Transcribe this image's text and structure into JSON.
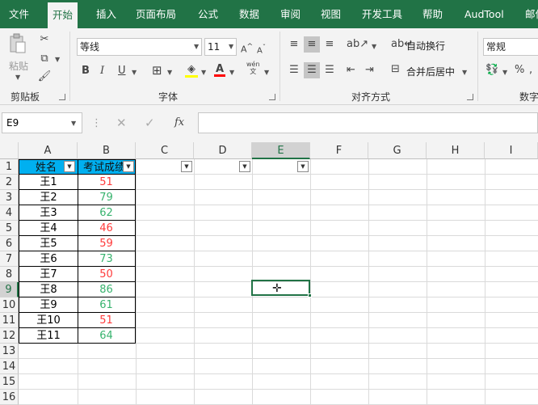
{
  "menu": {
    "tabs": [
      "文件",
      "开始",
      "插入",
      "页面布局",
      "公式",
      "数据",
      "审阅",
      "视图",
      "开发工具",
      "帮助",
      "AudTool",
      "邮件"
    ]
  },
  "ribbon": {
    "clipboard": {
      "label": "剪贴板",
      "paste_label": "粘贴"
    },
    "font": {
      "label": "字体",
      "font_name": "等线",
      "font_size": "11",
      "wen_label": "wén"
    },
    "alignment": {
      "label": "对齐方式",
      "wrap_text": "自动换行",
      "merge_center": "合并后居中"
    },
    "number": {
      "label": "数字",
      "format": "常规"
    }
  },
  "formula_bar": {
    "name_box": "E9",
    "fx": "fx",
    "content": ""
  },
  "columns": [
    "A",
    "B",
    "C",
    "D",
    "E",
    "F",
    "G",
    "H",
    "I"
  ],
  "rows": [
    "1",
    "2",
    "3",
    "4",
    "5",
    "6",
    "7",
    "8",
    "9",
    "10",
    "11",
    "12",
    "13",
    "14",
    "15",
    "16"
  ],
  "table": {
    "headers": [
      "姓名",
      "考试成绩"
    ],
    "names": [
      "王1",
      "王2",
      "王3",
      "王4",
      "王5",
      "王6",
      "王7",
      "王8",
      "王9",
      "王10",
      "王11"
    ],
    "scores": [
      "51",
      "79",
      "62",
      "46",
      "59",
      "73",
      "50",
      "86",
      "61",
      "51",
      "64"
    ]
  },
  "selected_cell": "E9",
  "colors": {
    "accent": "#217346",
    "header_fill": "#00b0f0",
    "low_score": "#ff3b3b",
    "high_score": "#38b36e"
  }
}
